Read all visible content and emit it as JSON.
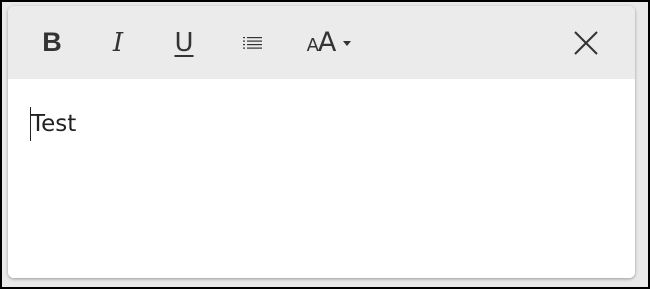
{
  "toolbar": {
    "bold": {
      "label": "B",
      "icon": "bold-icon"
    },
    "italic": {
      "label": "I",
      "icon": "italic-icon"
    },
    "underline": {
      "label": "U",
      "icon": "underline-icon"
    },
    "list": {
      "icon": "list-icon"
    },
    "font_size": {
      "small_label": "A",
      "large_label": "A",
      "icon": "font-size-icon",
      "dropdown_icon": "caret-down-icon"
    },
    "close": {
      "icon": "close-icon"
    }
  },
  "editor": {
    "text": "Test"
  },
  "colors": {
    "toolbar_bg": "#ebebeb",
    "panel_bg": "#ffffff",
    "icon": "#333333",
    "text": "#222222",
    "frame_border": "#000000"
  }
}
